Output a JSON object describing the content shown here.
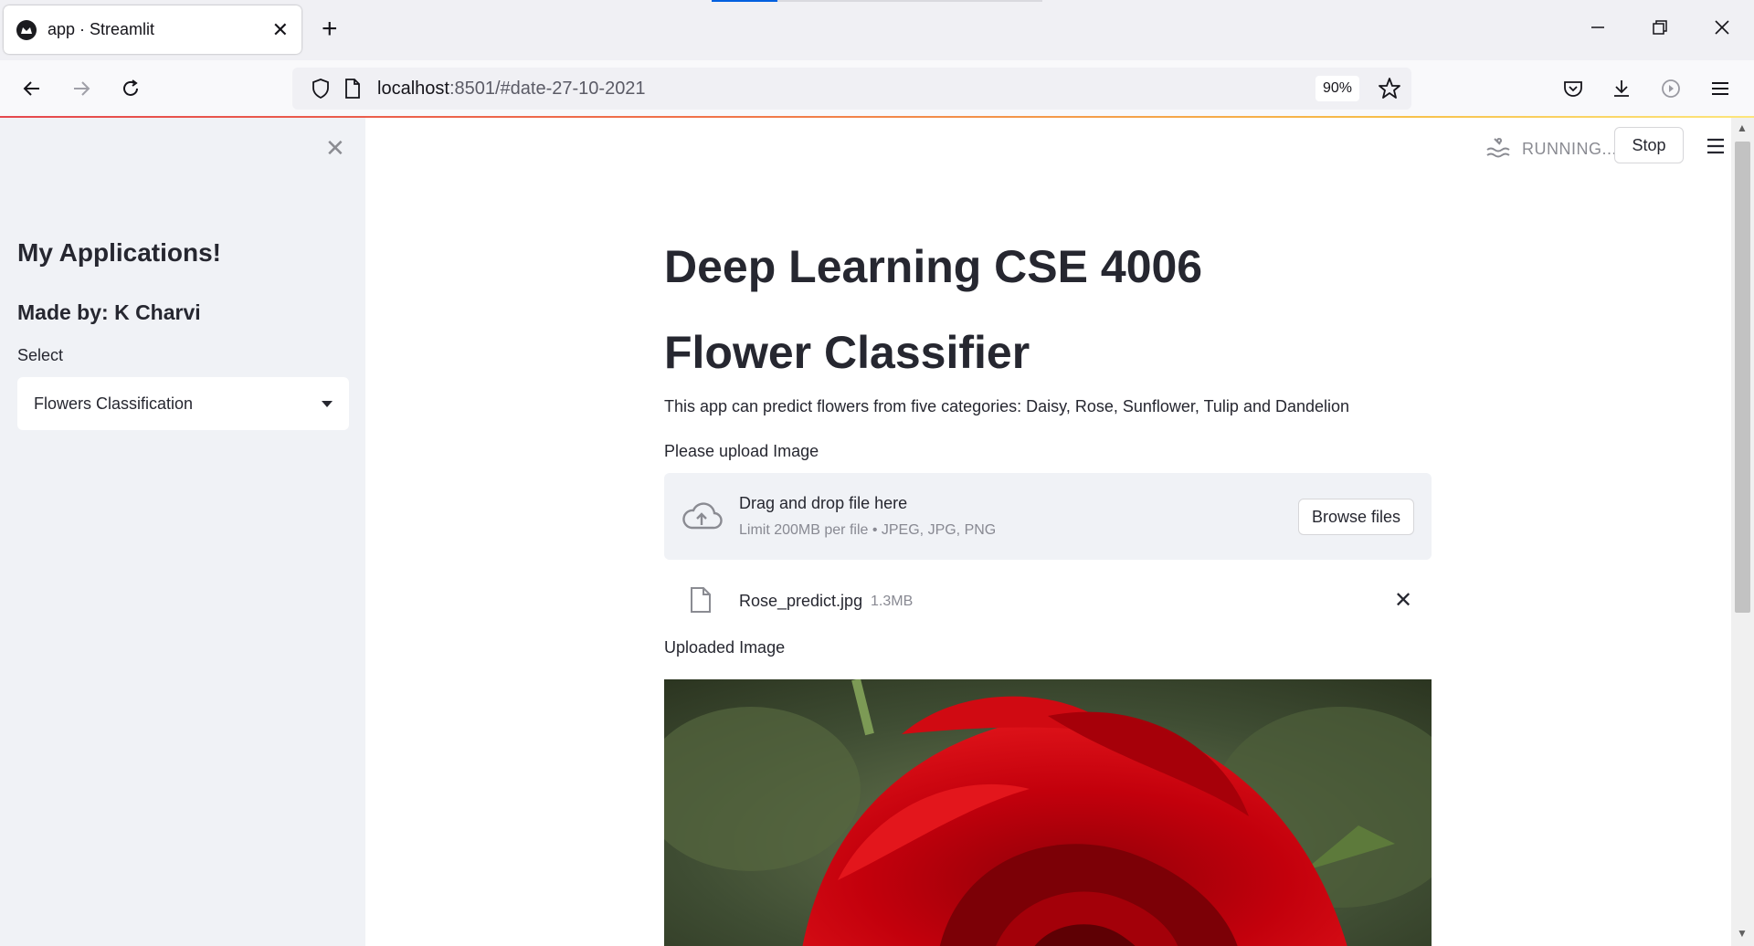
{
  "browser": {
    "tab_title": "app · Streamlit",
    "tab_close": "✕",
    "new_tab": "+",
    "url_host": "localhost",
    "url_rest": ":8501/#date-27-10-2021",
    "zoom": "90%",
    "icons": [
      "shield-icon",
      "page-icon",
      "star-icon",
      "pocket-icon",
      "download-icon",
      "extension-icon",
      "menu-icon"
    ]
  },
  "sidebar": {
    "close": "✕",
    "heading": "My Applications!",
    "subheading": "Made by: K Charvi",
    "select_label": "Select",
    "select_value": "Flowers Classification"
  },
  "header": {
    "status": "RUNNING...",
    "stop_label": "Stop"
  },
  "main": {
    "title": "Deep Learning CSE 4006",
    "subtitle": "Flower Classifier",
    "description": "This app can predict flowers from five categories: Daisy, Rose, Sunflower, Tulip and Dandelion",
    "upload_label": "Please upload Image",
    "dropzone_title": "Drag and drop file here",
    "dropzone_limit": "Limit 200MB per file • JPEG, JPG, PNG",
    "browse_label": "Browse files",
    "file_name": "Rose_predict.jpg",
    "file_size": "1.3MB",
    "file_delete": "✕",
    "image_label": "Uploaded Image"
  },
  "colors": {
    "sidebar_bg": "#f0f2f6",
    "text": "#262730",
    "muted": "#888992",
    "rose": "#b3000b",
    "foliage": "#4a5a3a"
  }
}
